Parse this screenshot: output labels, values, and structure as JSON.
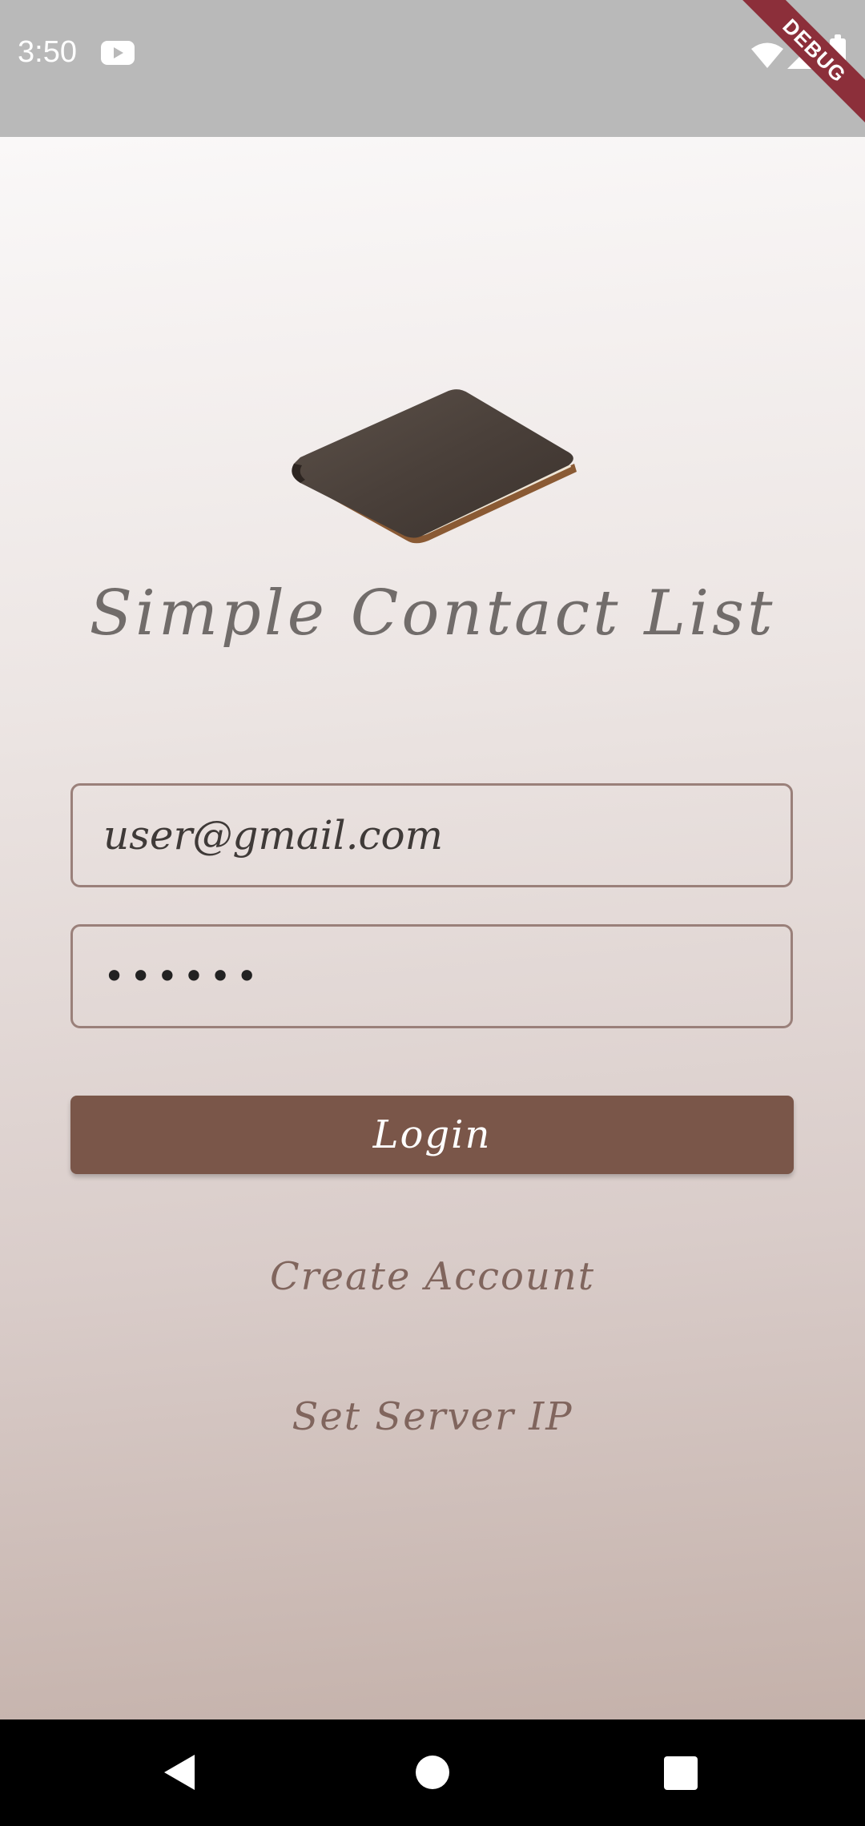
{
  "status_bar": {
    "time": "3:50",
    "debug_label": "DEBUG",
    "icons": [
      "youtube-icon",
      "wifi-icon",
      "signal-icon",
      "battery-icon"
    ]
  },
  "app": {
    "title": "Simple Contact List",
    "logo": "notebook-icon"
  },
  "form": {
    "email_value": "user@gmail.com",
    "password_value": "••••••",
    "login_label": "Login"
  },
  "links": {
    "create_account": "Create Account",
    "set_server_ip": "Set Server IP"
  },
  "colors": {
    "primary": "#7a5649",
    "link": "#80655d",
    "title": "#716c6a",
    "field_border": "#9a807a",
    "status_bar": "#b9b9b9",
    "debug_banner": "#8c2f3a"
  },
  "nav_bar": {
    "icons": [
      "back-icon",
      "home-icon",
      "recents-icon"
    ]
  }
}
